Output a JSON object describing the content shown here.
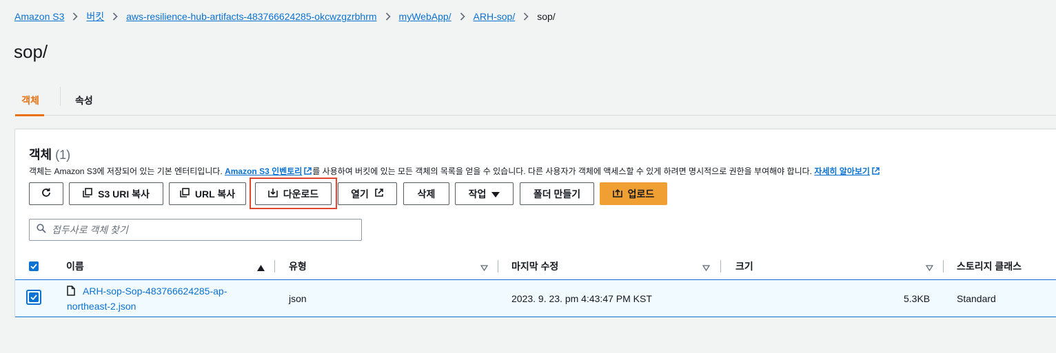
{
  "breadcrumb": [
    {
      "label": "Amazon S3"
    },
    {
      "label": "버킷"
    },
    {
      "label": "aws-resilience-hub-artifacts-483766624285-okcwzgzrbhrm"
    },
    {
      "label": "myWebApp/"
    },
    {
      "label": "ARH-sop/"
    }
  ],
  "breadcrumb_current": "sop/",
  "page_title": "sop/",
  "tabs": [
    {
      "label": "객체",
      "active": true
    },
    {
      "label": "속성",
      "active": false
    }
  ],
  "panel": {
    "title": "객체",
    "count": "(1)",
    "desc_prefix": "객체는 Amazon S3에 저장되어 있는 기본 엔터티입니다. ",
    "desc_link1": "Amazon S3 인벤토리",
    "desc_middle": "를 사용하여 버킷에 있는 모든 객체의 목록을 얻을 수 있습니다. 다른 사용자가 객체에 액세스할 수 있게 하려면 명시적으로 권한을 부여해야 합니다. ",
    "desc_link2": "자세히 알아보기"
  },
  "toolbar": {
    "refresh_icon": "refresh-icon",
    "copy_s3_uri": "S3 URI 복사",
    "copy_url": "URL 복사",
    "download": "다운로드",
    "open": "열기",
    "delete": "삭제",
    "actions": "작업",
    "create_folder": "폴더 만들기",
    "upload": "업로드"
  },
  "search": {
    "placeholder": "접두사로 객체 찾기",
    "value": ""
  },
  "table": {
    "columns": [
      "이름",
      "유형",
      "마지막 수정",
      "크기",
      "스토리지 클래스"
    ],
    "rows": [
      {
        "name_line1": "ARH-sop-Sop-483766624285-ap-",
        "name_line2": "northeast-2.json",
        "type": "json",
        "modified": "2023. 9. 23. pm 4:43:47 PM KST",
        "size": "5.3KB",
        "storage_class": "Standard",
        "selected": true
      }
    ]
  },
  "colors": {
    "accent": "#ec7211",
    "link": "#0972d3",
    "primary_button": "#f0a033",
    "highlight_box": "#e0452f"
  }
}
